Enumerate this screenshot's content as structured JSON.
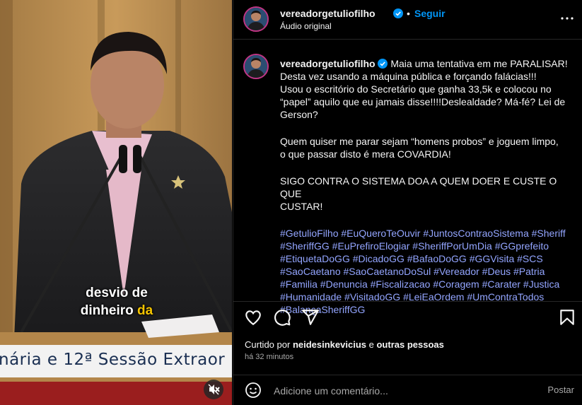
{
  "video": {
    "subtitle_words": [
      "desvio de",
      "dinheiro",
      "da"
    ],
    "banner_text": "nária e 12ª Sessão Extraor",
    "mute_icon": "speaker-muted-icon"
  },
  "header": {
    "username": "vereadorgetuliofilho",
    "separator": "•",
    "follow_label": "Seguir",
    "audio_label": "Áudio original",
    "more_icon": "more-options-icon"
  },
  "caption": {
    "username": "vereadorgetuliofilho",
    "lines": [
      "Maia uma tentativa em me PARALISAR!",
      "Desta vez usando a máquina pública e forçando falácias!!!",
      "Usou o escritório do Secretário que ganha 33,5k e colocou no",
      "“papel” aquilo que eu jamais disse!!!!Deslealdade? Má-fé? Lei de",
      "Gerson?"
    ],
    "para2": [
      "Quem quiser me parar sejam “homens probos” e joguem limpo,",
      "o que passar disto é mera COVARDIA!"
    ],
    "para3": [
      "SIGO CONTRA O SISTEMA DOA A QUEM DOER E CUSTE O QUE",
      "CUSTAR!"
    ],
    "hashtags": [
      "#GetulioFilho #EuQueroTeOuvir #JuntosContraoSistema #Sheriff",
      "#SheriffGG #EuPrefiroElogiar #SheriffPorUmDia #GGprefeito",
      "#EtiquetaDoGG #DicadoGG #BafaoDoGG #GGVisita #SCS",
      "#SaoCaetano #SaoCaetanoDoSul #Vereador #Deus #Patria",
      "#Familia #Denuncia #Fiscalizacao #Coragem #Carater #Justica",
      "#Humanidade #VisitadoGG #LeiEaOrdem #UmContraTodos",
      "#BalançaSheriffGG"
    ]
  },
  "actions": {
    "like_icon": "heart-icon",
    "comment_icon": "comment-icon",
    "share_icon": "share-icon",
    "save_icon": "bookmark-icon"
  },
  "likes": {
    "prefix": "Curtido por",
    "user": "neidesinkevicius",
    "connector": "e",
    "others": "outras pessoas"
  },
  "time_ago": "há 32 minutos",
  "comment": {
    "placeholder": "Adicione um comentário...",
    "post_label": "Postar",
    "emoji_icon": "emoji-icon"
  },
  "colors": {
    "accent": "#0095f6",
    "hashtag": "#93a5ff",
    "background": "#000000"
  }
}
